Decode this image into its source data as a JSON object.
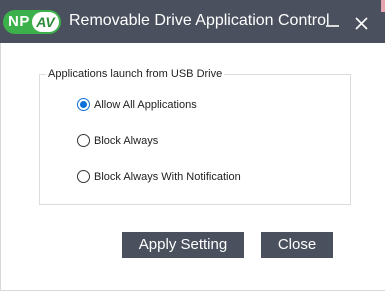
{
  "window": {
    "title": "Removable Drive Application Control",
    "logo": {
      "left_text": "NP",
      "right_text": "AV",
      "brand_green": "#3cb04a"
    },
    "controls": {
      "minimize_icon": "minimize-icon",
      "close_icon": "close-icon"
    },
    "titlebar_color": "#4a505e"
  },
  "group": {
    "legend": "Applications launch from USB Drive",
    "options": [
      {
        "label": "Allow All Applications",
        "selected": true
      },
      {
        "label": "Block Always",
        "selected": false
      },
      {
        "label": "Block Always With Notification",
        "selected": false
      }
    ]
  },
  "buttons": {
    "apply": "Apply Setting",
    "close": "Close"
  },
  "colors": {
    "radio_selected": "#0a6fd6",
    "button_bg": "#4a505e"
  }
}
